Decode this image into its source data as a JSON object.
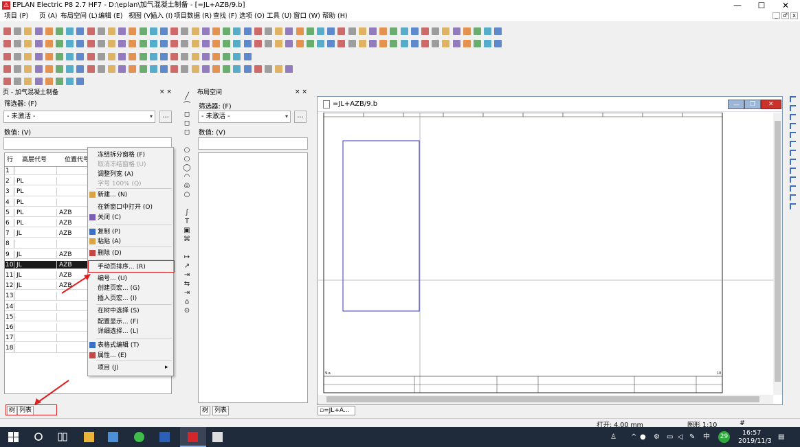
{
  "window": {
    "title": "EPLAN Electric P8 2.7 HF7 - D:\\eplan\\加气混凝土制备 - [=JL+AZB/9.b]",
    "minimize": "—",
    "maximize": "☐",
    "close": "✕"
  },
  "menu": {
    "items": [
      "项目 (P)",
      "页 (A)",
      "布局空间 (L)",
      "编辑 (E)",
      "视图 (V)",
      "插入 (I)",
      "项目数据 (R)",
      "查找 (F)",
      "选项 (O)",
      "工具 (U)",
      "窗口 (W)",
      "帮助 (H)"
    ],
    "mdi_controls": [
      "_",
      "♂",
      "x"
    ]
  },
  "page_panel": {
    "title": "页 - 加气混凝土制备",
    "close": "× ×",
    "filter_label": "筛选器: (F)",
    "filter_value": "- 未激活 -",
    "filter_btn": "...",
    "value_label": "数值: (V)",
    "columns": [
      "行",
      "高层代号",
      "位置代号"
    ],
    "rows": [
      {
        "n": "1",
        "h": "",
        "l": ""
      },
      {
        "n": "2",
        "h": "PL",
        "l": ""
      },
      {
        "n": "3",
        "h": "PL",
        "l": ""
      },
      {
        "n": "4",
        "h": "PL",
        "l": ""
      },
      {
        "n": "5",
        "h": "PL",
        "l": "AZB"
      },
      {
        "n": "6",
        "h": "PL",
        "l": "AZB"
      },
      {
        "n": "7",
        "h": "JL",
        "l": "AZB"
      },
      {
        "n": "8",
        "h": "",
        "l": ""
      },
      {
        "n": "9",
        "h": "JL",
        "l": "AZB"
      },
      {
        "n": "10",
        "h": "JL",
        "l": "AZB"
      },
      {
        "n": "11",
        "h": "JL",
        "l": "AZB"
      },
      {
        "n": "12",
        "h": "JL",
        "l": "AZB"
      },
      {
        "n": "13",
        "h": "",
        "l": ""
      },
      {
        "n": "14",
        "h": "",
        "l": ""
      },
      {
        "n": "15",
        "h": "",
        "l": ""
      },
      {
        "n": "16",
        "h": "",
        "l": ""
      },
      {
        "n": "17",
        "h": "",
        "l": ""
      },
      {
        "n": "18",
        "h": "",
        "l": ""
      }
    ],
    "tabs": [
      "树",
      "列表"
    ]
  },
  "context_menu": {
    "items": [
      {
        "label": "冻结拆分窗格 (F)",
        "disabled": false
      },
      {
        "label": "取消冻结窗格 (U)",
        "disabled": true
      },
      {
        "label": "调整列宽 (A)",
        "disabled": false
      },
      {
        "label": "字号 100% (Q)",
        "disabled": true
      },
      {
        "label": "新建... (N)",
        "disabled": false
      },
      {
        "label": "在新窗口中打开 (O)",
        "disabled": false
      },
      {
        "label": "关闭 (C)",
        "disabled": false
      },
      {
        "label": "复制 (P)",
        "disabled": false
      },
      {
        "label": "粘贴 (A)",
        "disabled": false
      },
      {
        "label": "删除 (D)",
        "disabled": false
      },
      {
        "label": "手动页排序... (R)",
        "disabled": false
      },
      {
        "label": "编号... (U)",
        "disabled": false
      },
      {
        "label": "创建页宏... (G)",
        "disabled": false
      },
      {
        "label": "插入页宏... (I)",
        "disabled": false
      },
      {
        "label": "在树中选择 (S)",
        "disabled": false
      },
      {
        "label": "配置显示... (F)",
        "disabled": false
      },
      {
        "label": "详细选择... (L)",
        "disabled": false
      },
      {
        "label": "表格式编辑 (T)",
        "disabled": false
      },
      {
        "label": "属性... (E)",
        "disabled": false
      },
      {
        "label": "项目 (J)",
        "disabled": false
      }
    ],
    "submenu_arrow": "▸"
  },
  "layout_panel": {
    "title": "布局空间",
    "close": "× ×",
    "filter_label": "筛选器: (F)",
    "filter_value": "- 未激活 -",
    "filter_btn": "...",
    "value_label": "数值: (V)",
    "tabs": [
      "树",
      "列表"
    ]
  },
  "document": {
    "title": "=JL+AZB/9.b",
    "tab_label": "=JL+A...",
    "title_block_left": "9.a",
    "title_block_right": "10"
  },
  "status": {
    "open": "打开: 4.00 mm",
    "grid": "图形 1:10",
    "hash": "#"
  },
  "taskbar": {
    "time": "16:57",
    "date": "2019/11/3",
    "ime": "中",
    "badge": "29"
  },
  "colors": {
    "accent_red": "#d2262a",
    "taskbar": "#1f2a3a",
    "selection": "#1a1a1a",
    "drawing_blue": "#3333cc"
  }
}
